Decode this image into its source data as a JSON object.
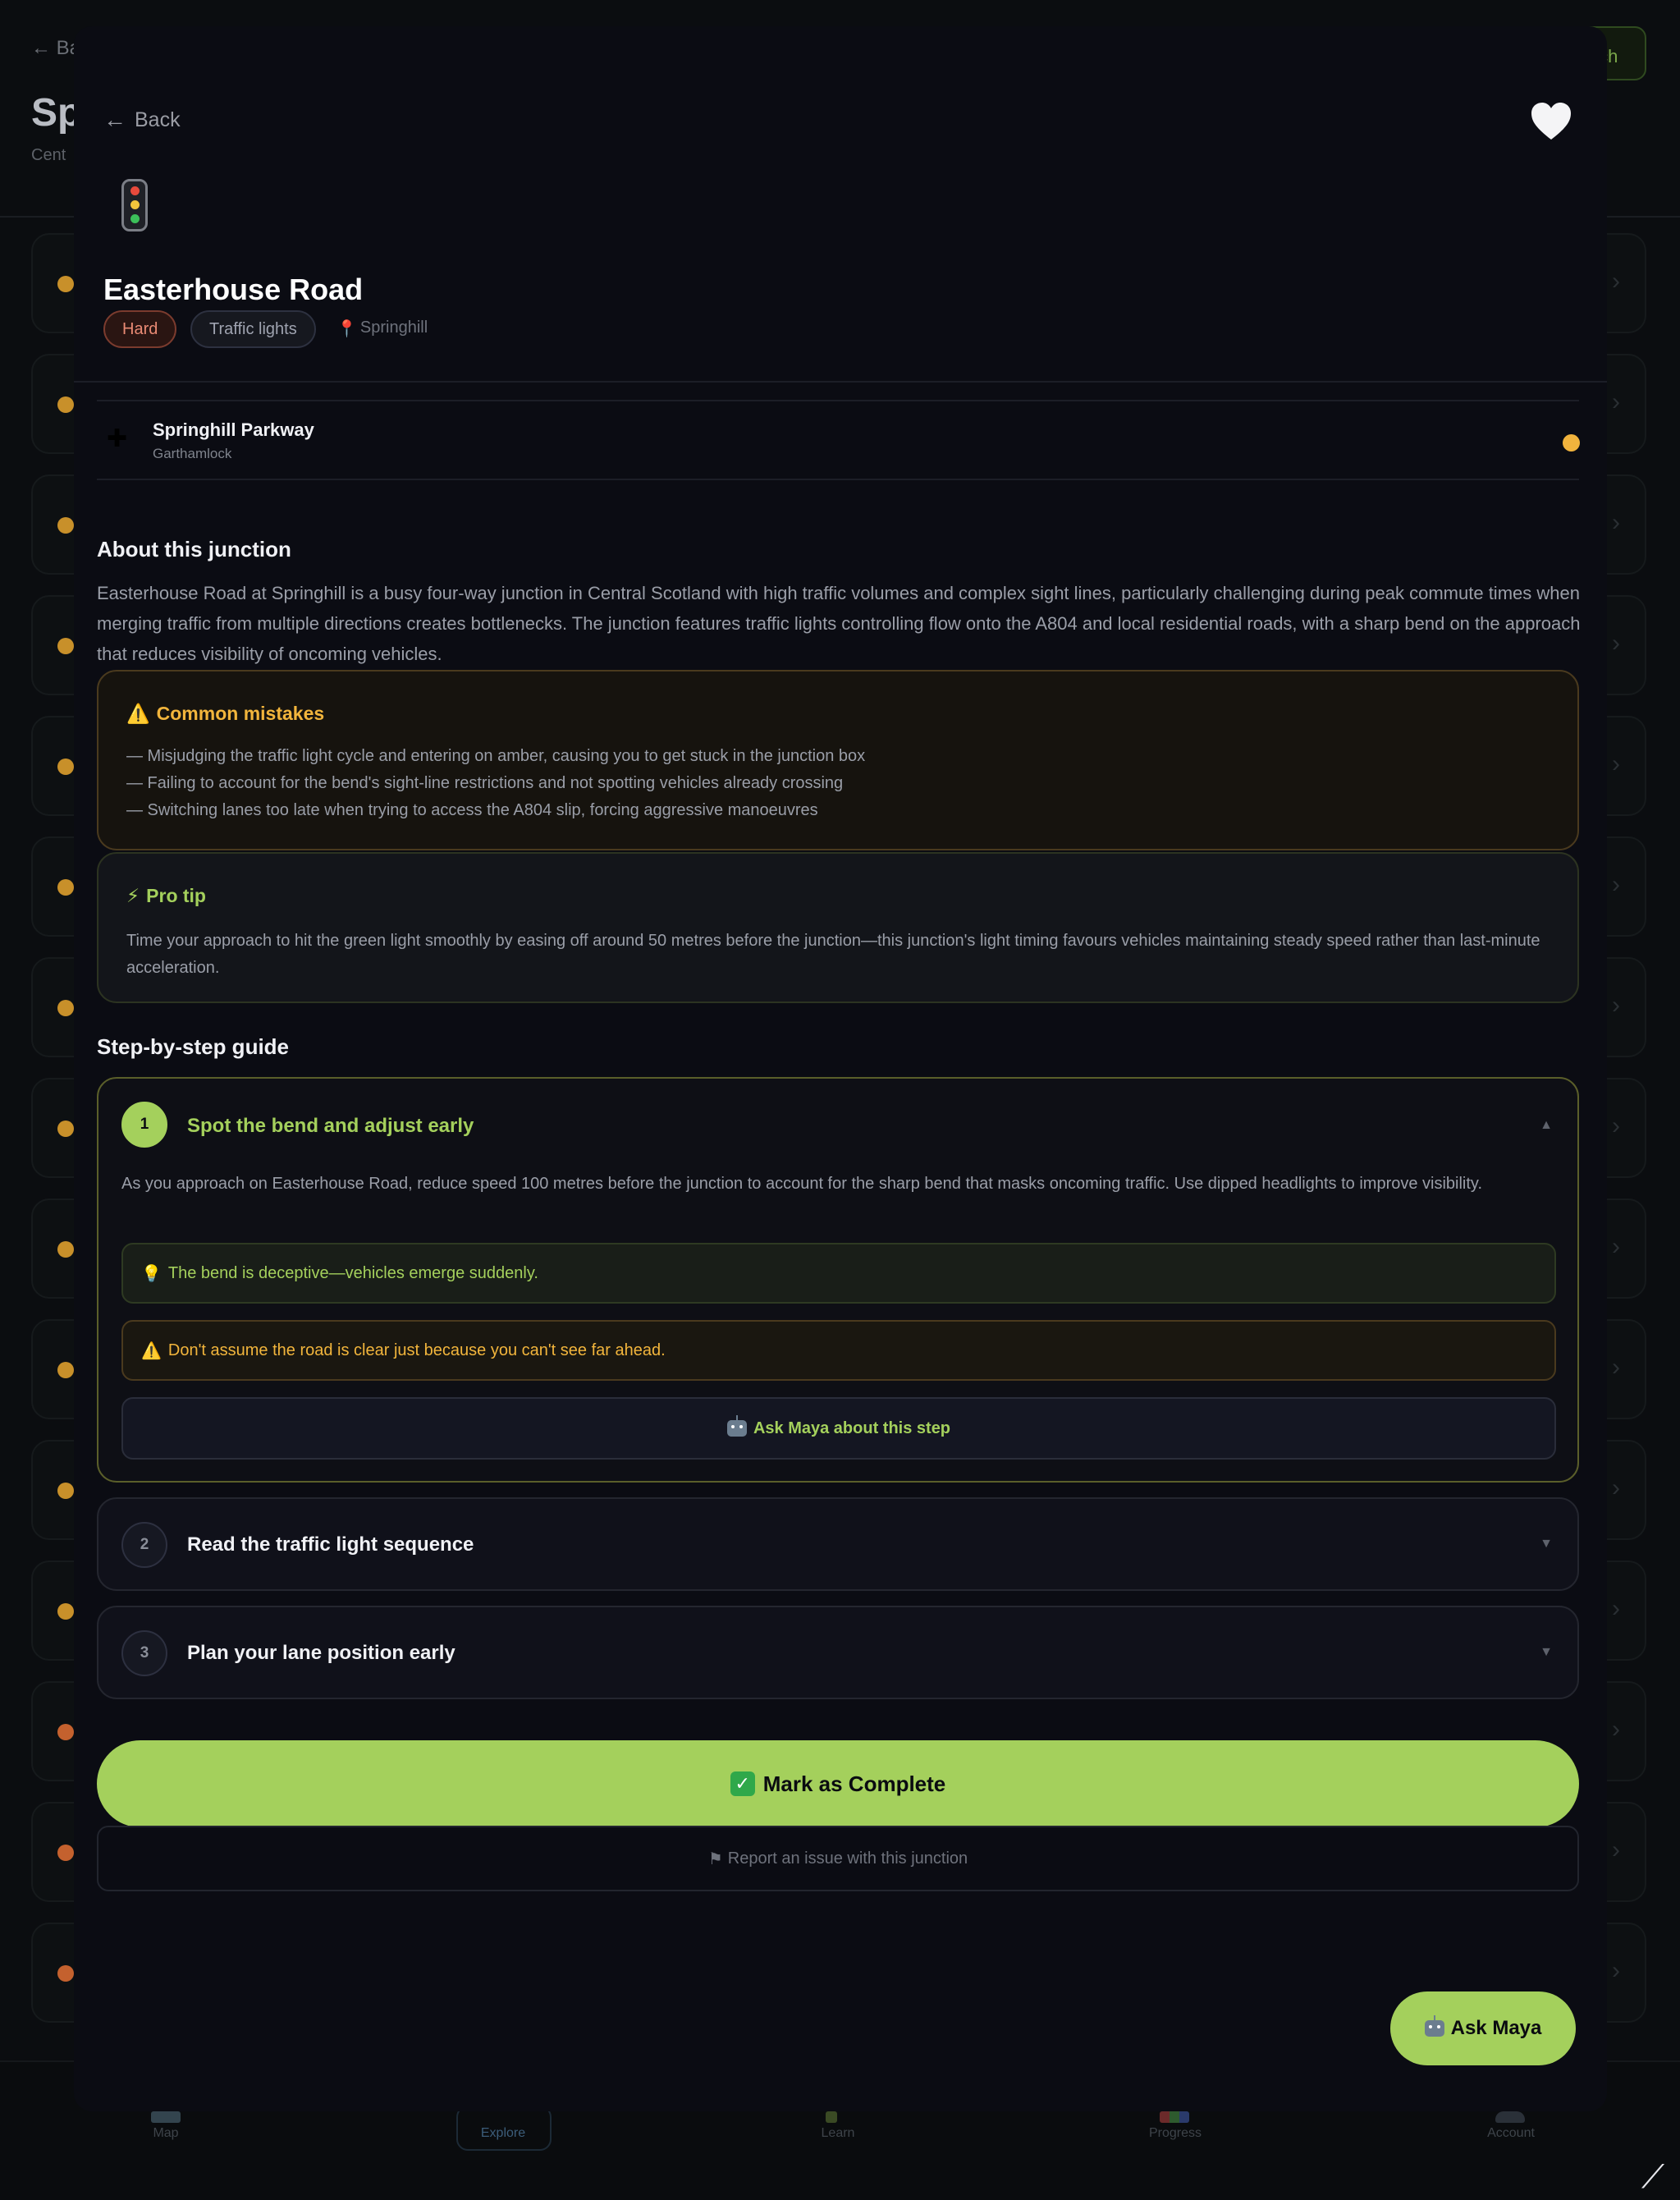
{
  "background": {
    "back_label": "← Ba",
    "title": "Sp",
    "subtitle": "Cent",
    "switch_label": "tch",
    "row_dot_colors": [
      "#c8902a",
      "#c8902a",
      "#c8902a",
      "#c8902a",
      "#c8902a",
      "#c8902a",
      "#c8902a",
      "#c8902a",
      "#c8902a",
      "#c8902a",
      "#c8902a",
      "#c8902a",
      "#c4612e",
      "#c4612e",
      "#c4612e"
    ],
    "nav": {
      "map": "Map",
      "explore": "Explore",
      "learn": "Learn",
      "progress": "Progress",
      "account": "Account"
    }
  },
  "modal": {
    "back_label": "Back",
    "favorite_icon": "heart-icon",
    "junction_icon": "traffic-light-icon",
    "title": "Easterhouse Road",
    "difficulty": "Hard",
    "junction_type": "Traffic lights",
    "location": "Springhill",
    "nearby": {
      "name": "Springhill Parkway",
      "area": "Garthamlock",
      "status_color": "#f1b33d"
    },
    "about": {
      "heading": "About this junction",
      "text": "Easterhouse Road at Springhill is a busy four-way junction in Central Scotland with high traffic volumes and complex sight lines, particularly challenging during peak commute times when merging traffic from multiple directions creates bottlenecks. The junction features traffic lights controlling flow onto the A804 and local residential roads, with a sharp bend on the approach that reduces visibility of oncoming vehicles."
    },
    "mistakes": {
      "heading": "Common mistakes",
      "items": [
        "— Misjudging the traffic light cycle and entering on amber, causing you to get stuck in the junction box",
        "— Failing to account for the bend's sight-line restrictions and not spotting vehicles already crossing",
        "— Switching lanes too late when trying to access the A804 slip, forcing aggressive manoeuvres"
      ]
    },
    "tip": {
      "heading": "Pro tip",
      "text": "Time your approach to hit the green light smoothly by easing off around 50 metres before the junction—this junction's light timing favours vehicles maintaining steady speed rather than last-minute acceleration."
    },
    "guide": {
      "heading": "Step-by-step guide",
      "steps": [
        {
          "number": "1",
          "title": "Spot the bend and adjust early",
          "body": "As you approach on Easterhouse Road, reduce speed 100 metres before the junction to account for the sharp bend that masks oncoming traffic. Use dipped headlights to improve visibility.",
          "hint": "The bend is deceptive—vehicles emerge suddenly.",
          "warning": "Don't assume the road is clear just because you can't see far ahead.",
          "ask_label": "Ask Maya about this step"
        },
        {
          "number": "2",
          "title": "Read the traffic light sequence"
        },
        {
          "number": "3",
          "title": "Plan your lane position early"
        }
      ]
    },
    "complete_label": "Mark as Complete",
    "report_label": "Report an issue with this junction",
    "ask_maya_label": "Ask Maya"
  },
  "colors": {
    "accent_green": "#a4d05c",
    "warning_amber": "#f2b53c",
    "hard_red": "#e98a74"
  }
}
